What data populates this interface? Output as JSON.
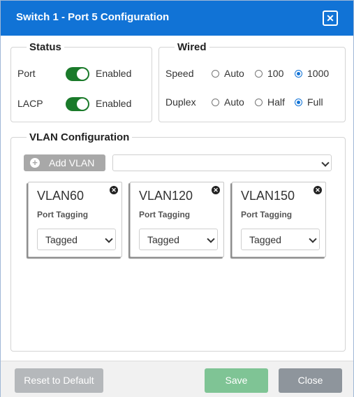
{
  "dialog": {
    "title": "Switch 1 - Port 5 Configuration",
    "close_icon": "close-icon",
    "title_bar_color": "#1173d6"
  },
  "status": {
    "legend": "Status",
    "port": {
      "label": "Port",
      "state": "Enabled",
      "on": true
    },
    "lacp": {
      "label": "LACP",
      "state": "Enabled",
      "on": true
    },
    "toggle_color": "#1a7a2a"
  },
  "wired": {
    "legend": "Wired",
    "speed": {
      "label": "Speed",
      "options": [
        "Auto",
        "100",
        "1000"
      ],
      "selected": "1000"
    },
    "duplex": {
      "label": "Duplex",
      "options": [
        "Auto",
        "Half",
        "Full"
      ],
      "selected": "Full"
    }
  },
  "vlan": {
    "legend": "VLAN Configuration",
    "add_button": "Add VLAN",
    "select_value": "",
    "cards": [
      {
        "name": "VLAN60",
        "sub": "Port Tagging",
        "tagging": "Tagged"
      },
      {
        "name": "VLAN120",
        "sub": "Port Tagging",
        "tagging": "Tagged"
      },
      {
        "name": "VLAN150",
        "sub": "Port Tagging",
        "tagging": "Tagged"
      }
    ]
  },
  "footer": {
    "reset": "Reset to Default",
    "save": "Save",
    "close": "Close",
    "save_color": "#7fc495",
    "close_color": "#8e959c",
    "reset_color": "#b5b8bb"
  }
}
